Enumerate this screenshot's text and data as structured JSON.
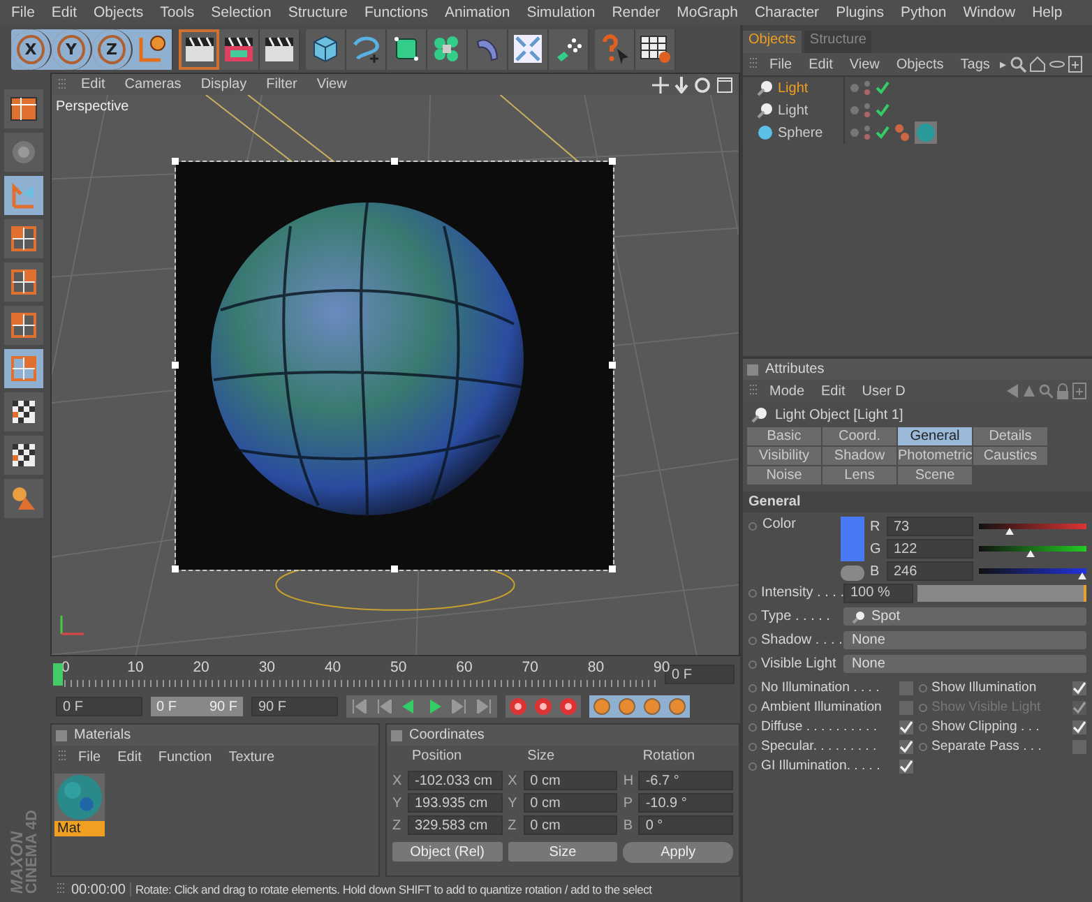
{
  "menu_bar": [
    "File",
    "Edit",
    "Objects",
    "Tools",
    "Selection",
    "Structure",
    "Functions",
    "Animation",
    "Simulation",
    "Render",
    "MoGraph",
    "Character",
    "Plugins",
    "Python",
    "Window",
    "Help"
  ],
  "toolbar": {
    "axis_buttons": [
      "X",
      "Y",
      "Z"
    ]
  },
  "viewport": {
    "menu": [
      "Edit",
      "Cameras",
      "Display",
      "Filter",
      "View"
    ],
    "camera_label": "Perspective"
  },
  "object_manager": {
    "tabs": [
      {
        "label": "Objects",
        "selected": true
      },
      {
        "label": "Structure",
        "selected": false
      }
    ],
    "menu": [
      "File",
      "Edit",
      "View",
      "Objects",
      "Tags"
    ],
    "more_arrow": "▸",
    "objects": [
      {
        "name": "Light",
        "kind": "light",
        "selected": true
      },
      {
        "name": "Light",
        "kind": "light",
        "selected": false
      },
      {
        "name": "Sphere",
        "kind": "sphere",
        "selected": false
      }
    ]
  },
  "attributes": {
    "title": "Attributes",
    "menu": [
      "Mode",
      "Edit",
      "User D"
    ],
    "object_title": "Light Object [Light 1]",
    "tabs": [
      {
        "label": "Basic",
        "selected": false
      },
      {
        "label": "Coord.",
        "selected": false
      },
      {
        "label": "General",
        "selected": true
      },
      {
        "label": "Details",
        "selected": false
      },
      {
        "label": "Visibility",
        "selected": false
      },
      {
        "label": "Shadow",
        "selected": false
      },
      {
        "label": "Photometric",
        "selected": false
      },
      {
        "label": "Caustics",
        "selected": false
      },
      {
        "label": "Noise",
        "selected": false
      },
      {
        "label": "Lens",
        "selected": false
      },
      {
        "label": "Scene",
        "selected": false
      }
    ],
    "section": "General",
    "color": {
      "label": "Color",
      "channels": [
        {
          "name": "R",
          "value": "73",
          "level": 0.286
        },
        {
          "name": "G",
          "value": "122",
          "level": 0.478
        },
        {
          "name": "B",
          "value": "246",
          "level": 0.965
        }
      ]
    },
    "intensity": {
      "label": "Intensity . . . .",
      "value": "100 %",
      "level": 1
    },
    "dropdowns": [
      {
        "label": "Type . . . . .",
        "value": "Spot",
        "kind": "light"
      },
      {
        "label": "Shadow . . . .",
        "value": "None",
        "kind": "plain"
      },
      {
        "label": "Visible Light",
        "value": "None",
        "kind": "plain"
      }
    ],
    "checkboxes": [
      {
        "label": "No Illumination . . . .",
        "checked": false,
        "disabled": false
      },
      {
        "label": "Show Illumination",
        "checked": true,
        "disabled": false
      },
      {
        "label": "Ambient Illumination",
        "checked": false,
        "disabled": false
      },
      {
        "label": "Show Visible Light",
        "checked": true,
        "disabled": true
      },
      {
        "label": "Diffuse . . . . . . . . . .",
        "checked": true,
        "disabled": false
      },
      {
        "label": "Show Clipping . . .",
        "checked": true,
        "disabled": false
      },
      {
        "label": "Specular. . . . . . . . .",
        "checked": true,
        "disabled": false
      },
      {
        "label": "Separate Pass . . .",
        "checked": false,
        "disabled": false
      },
      {
        "label": "GI Illumination. . . . .",
        "checked": true,
        "disabled": false
      }
    ]
  },
  "timeline": {
    "ticks": [
      "0",
      "10",
      "20",
      "30",
      "40",
      "50",
      "60",
      "70",
      "80",
      "90"
    ],
    "playhead": {
      "level": 0
    },
    "current_frame": "0 F",
    "start": "0 F",
    "range_start": "0 F",
    "range_end": "90 F",
    "end": "90 F"
  },
  "materials": {
    "title": "Materials",
    "menu": [
      "File",
      "Edit",
      "Function",
      "Texture"
    ],
    "items": [
      {
        "name": "Mat",
        "selected": true
      }
    ]
  },
  "coordinates": {
    "title": "Coordinates",
    "columns": [
      "Position",
      "Size",
      "Rotation"
    ],
    "rows": [
      {
        "cells": [
          {
            "axis": "X",
            "value": "-102.033 cm"
          },
          {
            "axis": "X",
            "value": "0 cm"
          },
          {
            "axis": "H",
            "value": "-6.7 °"
          }
        ]
      },
      {
        "cells": [
          {
            "axis": "Y",
            "value": "193.935 cm"
          },
          {
            "axis": "Y",
            "value": "0 cm"
          },
          {
            "axis": "P",
            "value": "-10.9 °"
          }
        ]
      },
      {
        "cells": [
          {
            "axis": "Z",
            "value": "329.583 cm"
          },
          {
            "axis": "Z",
            "value": "0 cm"
          },
          {
            "axis": "B",
            "value": "0 °"
          }
        ]
      }
    ],
    "mode": "Object (Rel)",
    "size_mode": "Size",
    "apply": "Apply"
  },
  "brand": {
    "line1": "MAXON",
    "line2": "CINEMA 4D"
  },
  "status_bar": {
    "time": "00:00:00",
    "message": "Rotate: Click and drag to rotate elements. Hold down SHIFT to add to quantize rotation / add to the select"
  }
}
